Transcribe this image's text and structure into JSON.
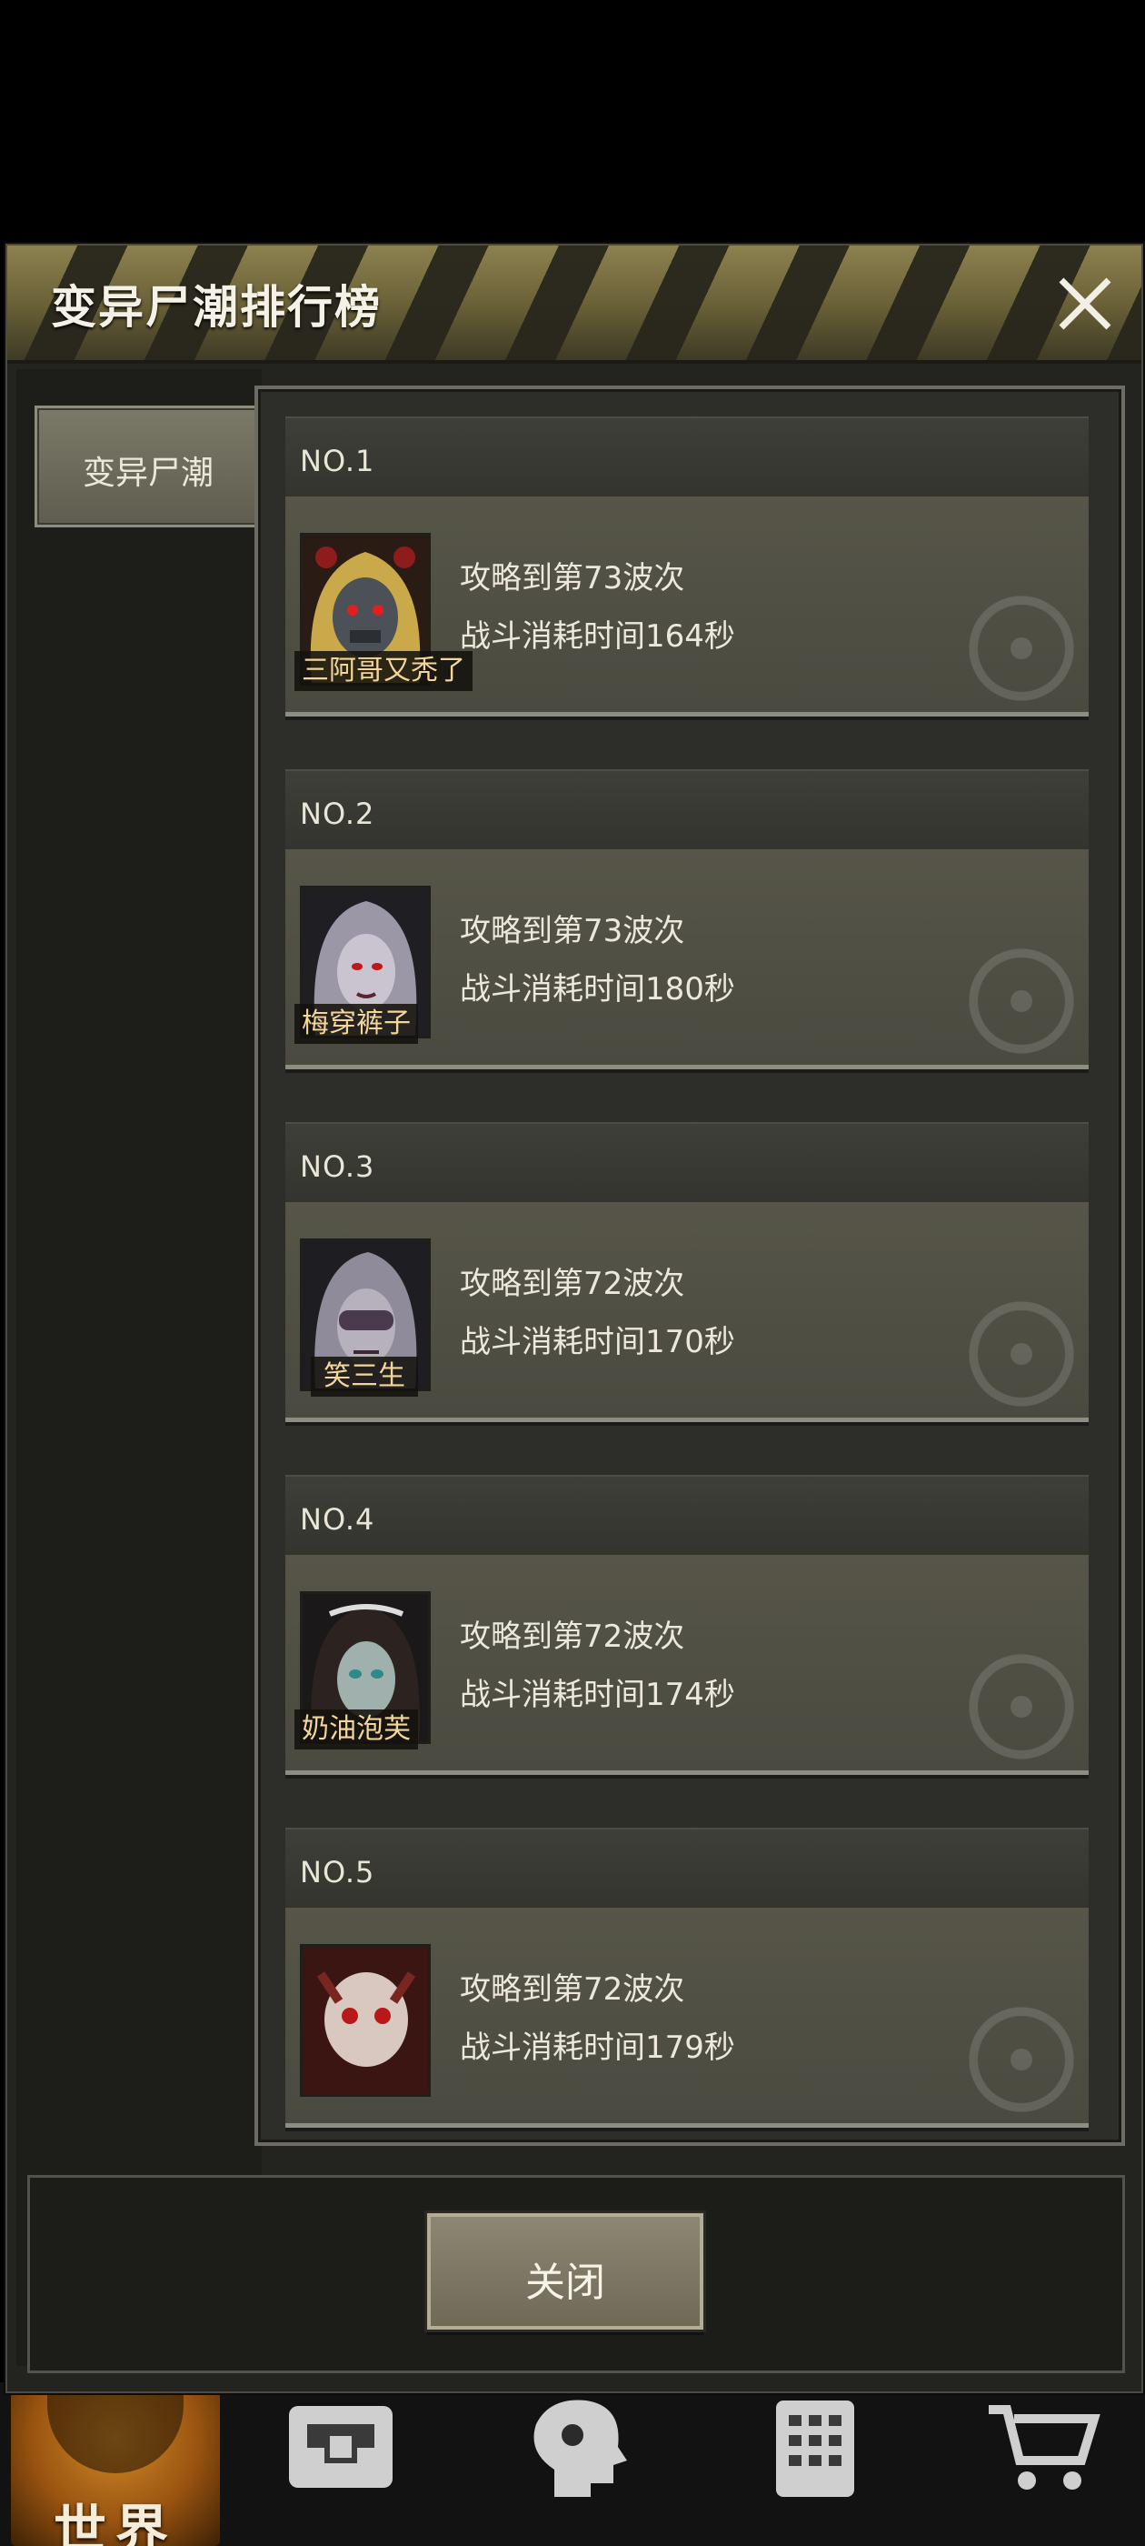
{
  "dialog": {
    "title": "变异尸潮排行榜",
    "side_tab": "变异尸潮",
    "close_button": "关闭"
  },
  "ranking": [
    {
      "rank": "NO.1",
      "name": "三阿哥又秃了",
      "progress": "攻略到第73波次",
      "time": "战斗消耗时间164秒",
      "avatar_color": "#c9a94a"
    },
    {
      "rank": "NO.2",
      "name": "梅穿裤子",
      "progress": "攻略到第73波次",
      "time": "战斗消耗时间180秒",
      "avatar_color": "#9b97a6"
    },
    {
      "rank": "NO.3",
      "name": "笑三生",
      "progress": "攻略到第72波次",
      "time": "战斗消耗时间170秒",
      "avatar_color": "#8f8b9b"
    },
    {
      "rank": "NO.4",
      "name": "奶油泡芙",
      "progress": "攻略到第72波次",
      "time": "战斗消耗时间174秒",
      "avatar_color": "#4b3a2c"
    },
    {
      "rank": "NO.5",
      "name": "",
      "progress": "攻略到第72波次",
      "time": "战斗消耗时间179秒",
      "avatar_color": "#7a2620"
    }
  ],
  "bottom_nav": {
    "world_label": "世界",
    "icons": [
      "backpack-icon",
      "head-icon",
      "phone-icon",
      "cart-icon"
    ]
  }
}
